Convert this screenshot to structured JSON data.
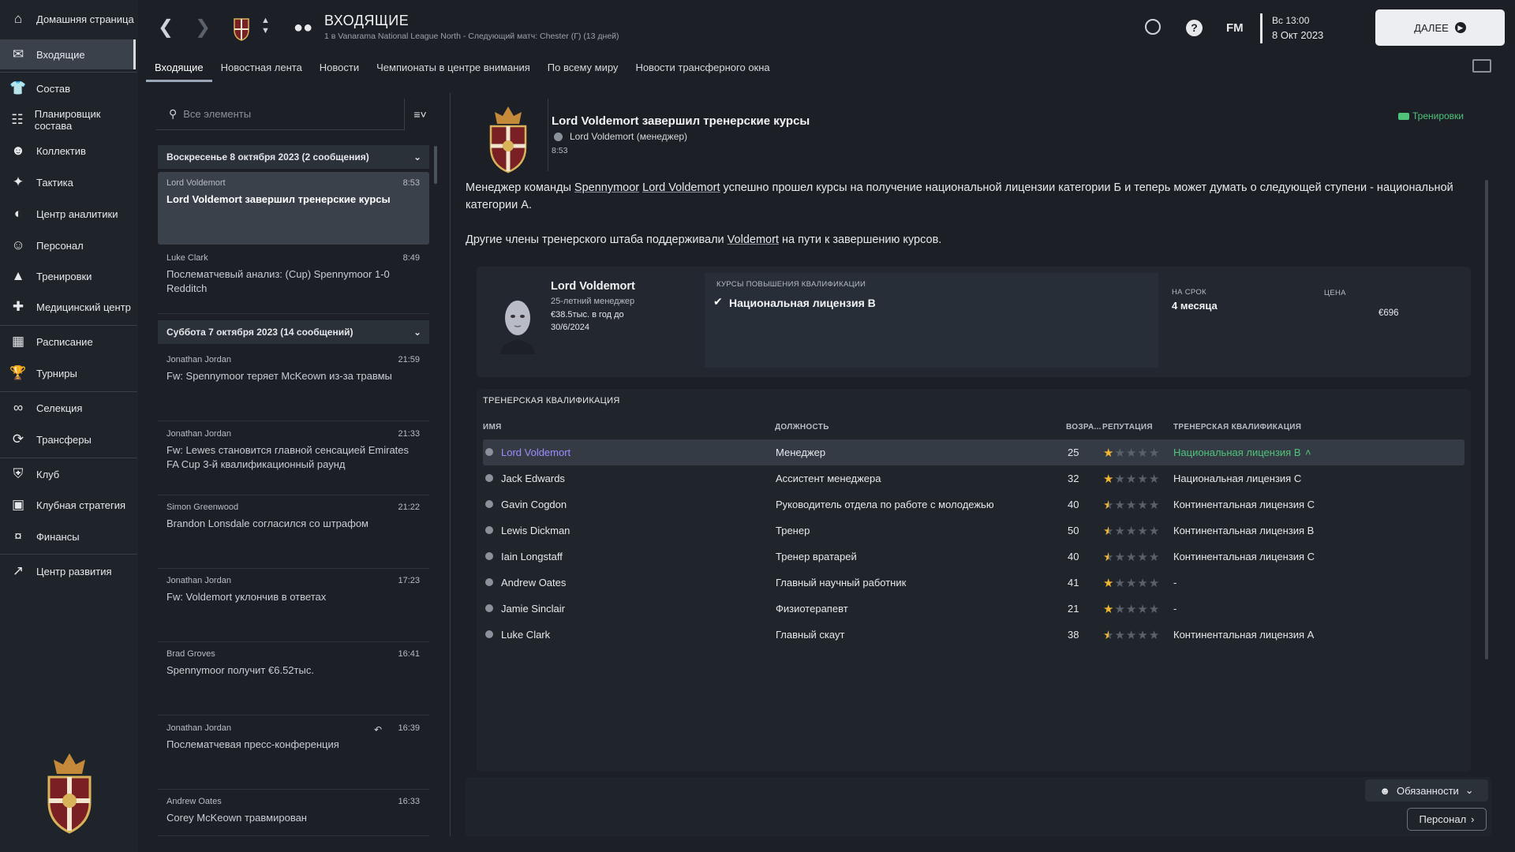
{
  "sidebar": {
    "items": [
      {
        "label": "Домашняя страница",
        "icon": "home-icon",
        "glyph": "⌂"
      },
      {
        "label": "Входящие",
        "icon": "mail-icon",
        "glyph": "✉"
      },
      {
        "label": "Состав",
        "icon": "shirt-icon",
        "glyph": "👕"
      },
      {
        "label": "Планировщик состава",
        "icon": "clipboard-icon",
        "glyph": "☷"
      },
      {
        "label": "Коллектив",
        "icon": "team-icon",
        "glyph": "☻"
      },
      {
        "label": "Тактика",
        "icon": "tactics-icon",
        "glyph": "✦"
      },
      {
        "label": "Центр аналитики",
        "icon": "analytics-icon",
        "glyph": "◐"
      },
      {
        "label": "Персонал",
        "icon": "staff-icon",
        "glyph": "☺"
      },
      {
        "label": "Тренировки",
        "icon": "training-cone-icon",
        "glyph": "▲"
      },
      {
        "label": "Медицинский центр",
        "icon": "medical-icon",
        "glyph": "✚"
      },
      {
        "label": "Расписание",
        "icon": "calendar-icon",
        "glyph": "▦"
      },
      {
        "label": "Турниры",
        "icon": "trophy-icon",
        "glyph": "🏆"
      },
      {
        "label": "Селекция",
        "icon": "binoculars-icon",
        "glyph": "∞"
      },
      {
        "label": "Трансферы",
        "icon": "transfer-icon",
        "glyph": "⟳"
      },
      {
        "label": "Клуб",
        "icon": "club-shield-icon",
        "glyph": "⛨"
      },
      {
        "label": "Клубная стратегия",
        "icon": "strategy-icon",
        "glyph": "▣"
      },
      {
        "label": "Финансы",
        "icon": "finance-icon",
        "glyph": "¤"
      },
      {
        "label": "Центр развития",
        "icon": "development-icon",
        "glyph": "↗"
      }
    ]
  },
  "header": {
    "title": "ВХОДЯЩИЕ",
    "subtitle": "1 в Vanarama National League North - Следующий матч: Chester (Г) (13 дней)",
    "fm_label": "FM",
    "date_line1": "Вс 13:00",
    "date_line2": "8 Окт 2023",
    "continue_label": "ДАЛЕЕ"
  },
  "tabs": [
    "Входящие",
    "Новостная лента",
    "Новости",
    "Чемпионаты в центре внимания",
    "По всему миру",
    "Новости трансферного окна"
  ],
  "inbox": {
    "search_placeholder": "Все элементы",
    "groups": [
      {
        "header": "Воскресенье 8 октября 2023 (2 сообщения)"
      },
      {
        "header": "Суббота 7 октября 2023 (14 сообщений)"
      }
    ],
    "messages": [
      {
        "sender": "Lord Voldemort",
        "time": "8:53",
        "subject": "Lord Voldemort завершил тренерские курсы"
      },
      {
        "sender": "Luke Clark",
        "time": "8:49",
        "subject": "Послематчевый анализ: (Cup) Spennymoor 1-0 Redditch"
      },
      {
        "sender": "Jonathan Jordan",
        "time": "21:59",
        "subject": "Fw: Spennymoor теряет McKeown из-за травмы"
      },
      {
        "sender": "Jonathan Jordan",
        "time": "21:33",
        "subject": "Fw: Lewes становится главной сенсацией Emirates FA Cup 3-й квалификационный раунд"
      },
      {
        "sender": "Simon Greenwood",
        "time": "21:22",
        "subject": "Brandon Lonsdale согласился со штрафом"
      },
      {
        "sender": "Jonathan Jordan",
        "time": "17:23",
        "subject": "Fw: Voldemort уклончив в ответах"
      },
      {
        "sender": "Brad Groves",
        "time": "16:41",
        "subject": "Spennymoor получит €6.52тыс."
      },
      {
        "sender": "Jonathan Jordan",
        "time": "16:39",
        "subject": "Послематчевая пресс-конференция"
      },
      {
        "sender": "Andrew Oates",
        "time": "16:33",
        "subject": "Corey McKeown травмирован"
      }
    ]
  },
  "detail": {
    "title": "Lord Voldemort завершил тренерские курсы",
    "author": "Lord Voldemort  (менеджер)",
    "time": "8:53",
    "tag": "Тренировки",
    "p1_a": "Менеджер команды ",
    "p1_link1": "Spennymoor",
    "p1_sp": " ",
    "p1_link2": "Lord Voldemort",
    "p1_b": " успешно прошел курсы на получение национальной лицензии категории Б и теперь может думать о следующей ступени - национальной категории А.",
    "p2_a": "Другие члены тренерского штаба поддерживали ",
    "p2_link": "Voldemort",
    "p2_b": " на пути к завершению курсов.",
    "card": {
      "name": "Lord Voldemort",
      "age_role": "25-летний менеджер",
      "wage": "€38.5тыс. в год до",
      "until": "30/6/2024",
      "course_header": "КУРСЫ ПОВЫШЕНИЯ КВАЛИФИКАЦИИ",
      "course_name": "Национальная лицензия B",
      "duration_header": "НА СРОК",
      "duration": "4 месяца",
      "price_header": "ЦЕНА",
      "price": "€696"
    },
    "staff_section": "ТРЕНЕРСКАЯ КВАЛИФИКАЦИЯ",
    "columns": [
      "ИМЯ",
      "ДОЛЖНОСТЬ",
      "ВОЗРА...",
      "РЕПУТАЦИЯ",
      "ТРЕНЕРСКАЯ КВАЛИФИКАЦИЯ"
    ],
    "staff": [
      {
        "name": "Lord Voldemort",
        "role": "Менеджер",
        "age": "25",
        "rep": 1,
        "qual": "Национальная лицензия B"
      },
      {
        "name": "Jack Edwards",
        "role": "Ассистент менеджера",
        "age": "32",
        "rep": 1,
        "qual": "Национальная лицензия C"
      },
      {
        "name": "Gavin Cogdon",
        "role": "Руководитель отдела по работе с молодежью",
        "age": "40",
        "rep": 0.5,
        "qual": "Континентальная лицензия C"
      },
      {
        "name": "Lewis Dickman",
        "role": "Тренер",
        "age": "50",
        "rep": 0.5,
        "qual": "Континентальная лицензия B"
      },
      {
        "name": "Iain Longstaff",
        "role": "Тренер вратарей",
        "age": "40",
        "rep": 0.5,
        "qual": "Континентальная лицензия C"
      },
      {
        "name": "Andrew Oates",
        "role": "Главный научный работник",
        "age": "41",
        "rep": 1,
        "qual": "-"
      },
      {
        "name": "Jamie Sinclair",
        "role": "Физиотерапевт",
        "age": "21",
        "rep": 1,
        "qual": "-"
      },
      {
        "name": "Luke Clark",
        "role": "Главный скаут",
        "age": "38",
        "rep": 0.5,
        "qual": "Континентальная лицензия A"
      }
    ]
  },
  "bottom": {
    "duties_label": "Обязанности",
    "staff_label": "Персонал"
  },
  "colors": {
    "accent_green": "#4fc37a",
    "link_purple": "#9d8cff",
    "star_gold": "#f2b632"
  }
}
